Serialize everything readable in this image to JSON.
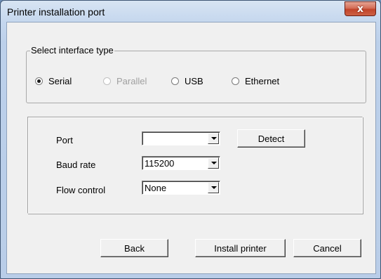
{
  "window": {
    "title": "Printer installation port",
    "close_symbol": "x"
  },
  "interface_group": {
    "legend": "Select interface type",
    "options": [
      {
        "label": "Serial",
        "checked": true,
        "enabled": true
      },
      {
        "label": "Parallel",
        "checked": false,
        "enabled": false
      },
      {
        "label": "USB",
        "checked": false,
        "enabled": true
      },
      {
        "label": "Ethernet",
        "checked": false,
        "enabled": true
      }
    ]
  },
  "settings": {
    "port_label": "Port",
    "port_value": "",
    "detect_label": "Detect",
    "baud_label": "Baud rate",
    "baud_value": "115200",
    "flow_label": "Flow control",
    "flow_value": "None"
  },
  "footer": {
    "back_label": "Back",
    "install_label": "Install printer",
    "cancel_label": "Cancel"
  }
}
